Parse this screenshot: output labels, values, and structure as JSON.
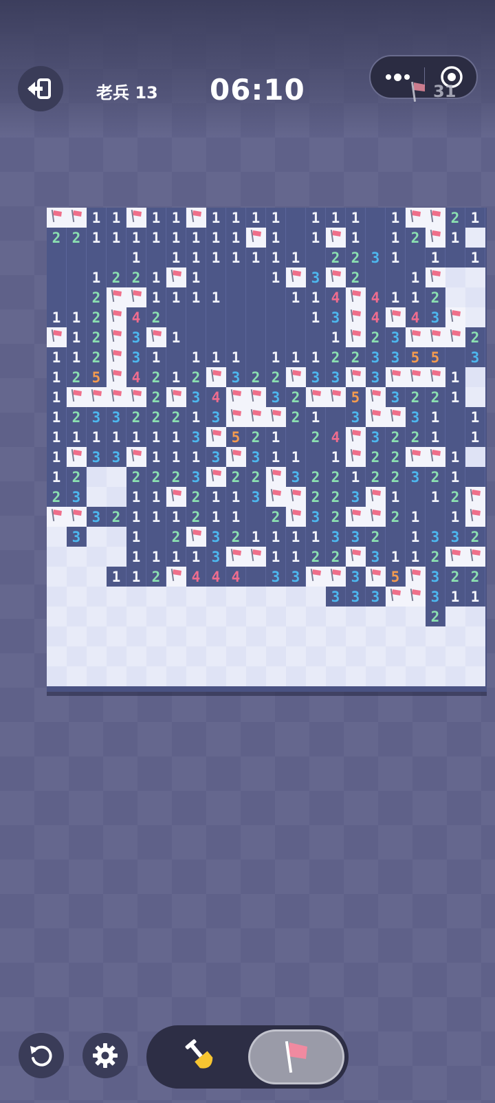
{
  "header": {
    "level": "老兵 13",
    "timer": "06:10",
    "mines_remaining": "31",
    "icons": {
      "back": "exit-icon",
      "more": "more-dots-icon",
      "target": "target-icon",
      "flag": "flag-icon"
    }
  },
  "board": {
    "rows": [
      "FF11F11F1111.111.1FF21",
      "2211111111F1.1F1.12F1",
      "....1.1111111.2231.1.122",
      "..1221F1...1F3F2..1F",
      "..2FF1111...114F4112",
      "112F42.......13F4F43F",
      "F12F3F1.......1F23FFF2",
      "112F31.111.111223355 31",
      "125F4212F322F33F3FFF1",
      "1FFFF2F34FF32FF5F3221",
      "123322213FFF21 3FF31 1F",
      "11111113F521.24F3221 11",
      "1F33F1113F311.1F22FF1",
      "12HH2223F22F322122321 11",
      "23HH11F2113FF223F1.12F",
      "FF32111211 2F32FF21.1F2",
      "H3HH1.2F321111332.1332",
      "HHHH11113FF1122F3112FF1",
      "HHH112F444 33FF3F5F3221",
      "HHHHHHHHHHHHHH333FF3111",
      "HHHHHHHHHHHHHHHHHHH2HH",
      "HHHHHHHHHHHHHHHHHHHHHH",
      "HHHHHHHHHHHHHHHHHHHHHH",
      "HHHHHHHHHHHHHHHHHHHHHH"
    ],
    "cols": 22
  },
  "toolbar": {
    "restart_icon": "restart-icon",
    "settings_icon": "gear-icon",
    "dig_icon": "shovel-icon",
    "flag_icon": "flag-icon",
    "selected_mode": "flag"
  }
}
